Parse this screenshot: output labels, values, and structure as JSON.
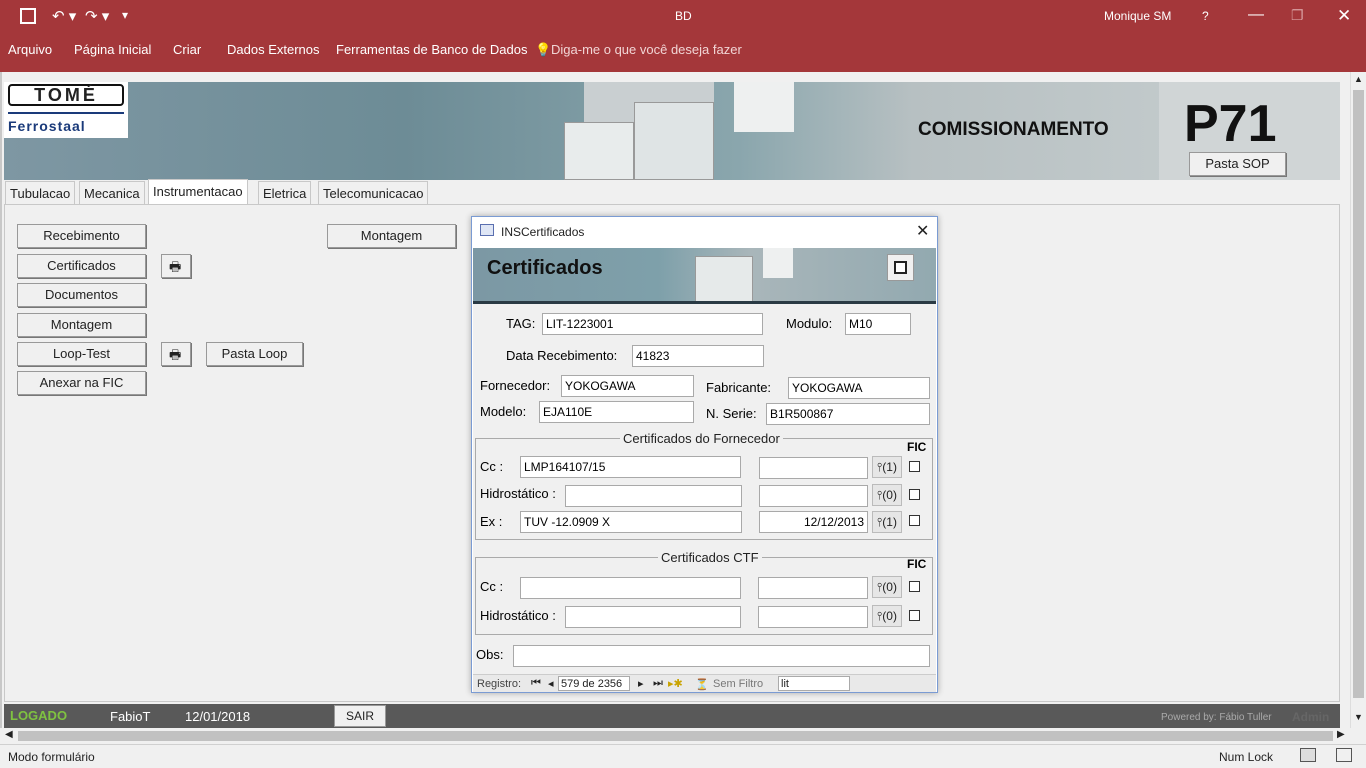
{
  "titlebar": {
    "title": "BD",
    "user": "Monique SM",
    "help": "?"
  },
  "menu": [
    "Arquivo",
    "Página Inicial",
    "Criar",
    "Dados Externos",
    "Ferramentas de Banco de Dados",
    "Diga-me o que você deseja fazer"
  ],
  "banner": {
    "logo_top": "TOMÉ",
    "logo_bottom": "Ferrostaal",
    "heading": "COMISSIONAMENTO",
    "project": "P71",
    "pasta_sop": "Pasta SOP"
  },
  "tabs": [
    "Tubulacao",
    "Mecanica",
    "Instrumentacao",
    "Eletrica",
    "Telecomunicacao"
  ],
  "left_buttons": {
    "recebimento": "Recebimento",
    "certificados": "Certificados",
    "documentos": "Documentos",
    "montagem": "Montagem",
    "loop_test": "Loop-Test",
    "anexar": "Anexar na FIC",
    "pasta_loop": "Pasta Loop",
    "montagem2": "Montagem"
  },
  "dialog": {
    "window_title": "INSCertificados",
    "heading": "Certificados",
    "tag_label": "TAG:",
    "tag": "LIT-1223001",
    "modulo_label": "Modulo:",
    "modulo": "M10",
    "data_label": "Data Recebimento:",
    "data": "41823",
    "fornecedor_label": "Fornecedor:",
    "fornecedor": "YOKOGAWA",
    "fabricante_label": "Fabricante:",
    "fabricante": "YOKOGAWA",
    "modelo_label": "Modelo:",
    "modelo": "EJA110E",
    "serie_label": "N. Serie:",
    "serie": "B1R500867",
    "group1_title": "Certificados do Fornecedor",
    "fic": "FIC",
    "cc_label": "Cc :",
    "cc_value": "LMP164107/15",
    "cc_date": "",
    "cc_clip": "(1)",
    "hidro_label": "Hidrostático :",
    "hidro_value": "",
    "hidro_date": "",
    "hidro_clip": "(0)",
    "ex_label": "Ex :",
    "ex_value": "TUV -12.0909 X",
    "ex_date": "12/12/2013",
    "ex_clip": "(1)",
    "group2_title": "Certificados CTF",
    "ctf_cc_label": "Cc :",
    "ctf_cc_clip": "(0)",
    "ctf_hidro_label": "Hidrostático :",
    "ctf_hidro_clip": "(0)",
    "obs_label": "Obs:",
    "nav": {
      "registro": "Registro:",
      "position": "579 de 2356",
      "filter": "Sem Filtro",
      "search": "lit"
    }
  },
  "footer": {
    "logado": "LOGADO",
    "user": "FabioT",
    "date": "12/01/2018",
    "sair": "SAIR",
    "powered": "Powered by: Fábio Tuller",
    "admin": "Admin"
  },
  "status": {
    "mode": "Modo formulário",
    "numlock": "Num Lock"
  },
  "colors": {
    "titlebar": "#a4373a",
    "logado": "#7fc241",
    "footer": "#595959"
  }
}
